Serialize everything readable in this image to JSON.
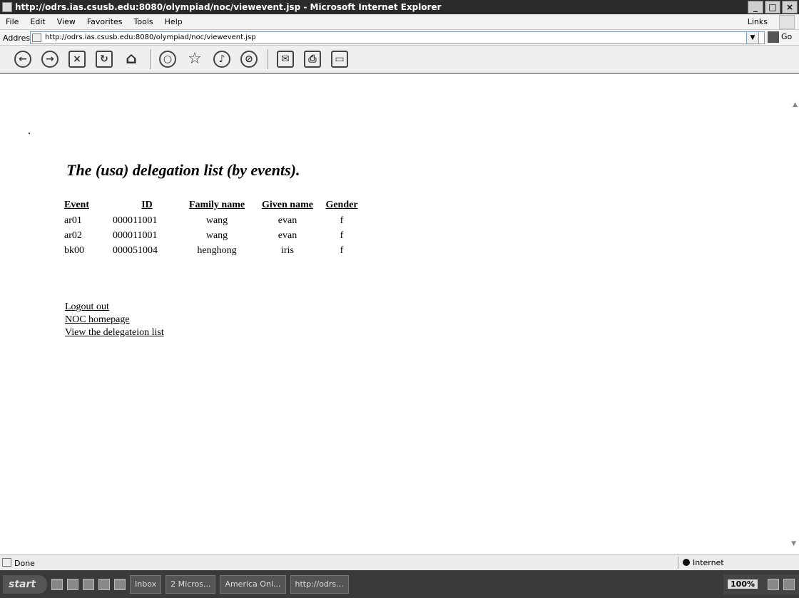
{
  "window": {
    "title": "http://odrs.ias.csusb.edu:8080/olympiad/noc/viewevent.jsp - Microsoft Internet Explorer",
    "controls": [
      "minimize",
      "maximize",
      "close"
    ]
  },
  "menu": {
    "items": [
      "File",
      "Edit",
      "View",
      "Favorites",
      "Tools",
      "Help"
    ],
    "links_label": "Links"
  },
  "address": {
    "label": "Address",
    "url": "http://odrs.ias.csusb.edu:8080/olympiad/noc/viewevent.jsp",
    "go_label": "Go"
  },
  "toolbar": {
    "icons": [
      "back-icon",
      "forward-icon",
      "stop-icon",
      "refresh-icon",
      "home-icon",
      "search-icon",
      "favorites-icon",
      "media-icon",
      "history-icon",
      "mail-icon",
      "print-icon",
      "folder-icon"
    ]
  },
  "page": {
    "heading": "The (usa) delegation list (by events).",
    "table": {
      "headers": [
        "Event",
        "ID",
        "Family name",
        "Given name",
        "Gender"
      ],
      "rows": [
        [
          "ar01",
          "000011001",
          "wang",
          "evan",
          "f"
        ],
        [
          "ar02",
          "000011001",
          "wang",
          "evan",
          "f"
        ],
        [
          "bk00",
          "000051004",
          "henghong",
          "iris",
          "f"
        ]
      ]
    },
    "links": [
      "Logout out",
      "NOC homepage",
      "View the delegateion list"
    ]
  },
  "status": {
    "text": "Done",
    "zone": "Internet"
  },
  "taskbar": {
    "start_label": "start",
    "tasks": [
      "Inbox",
      "2 Micros...",
      "America Onl...",
      "http://odrs..."
    ],
    "zoom": "100%"
  }
}
